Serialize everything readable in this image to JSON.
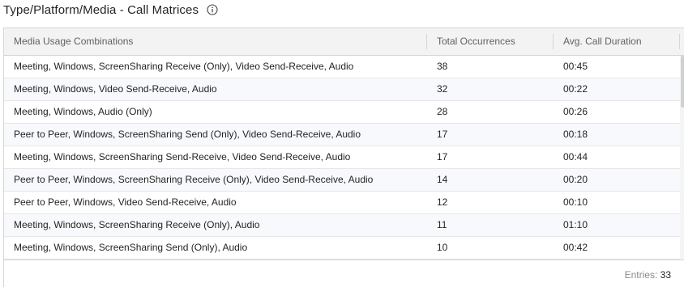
{
  "header": {
    "title": "Type/Platform/Media - Call Matrices",
    "info_icon": "info-circle-icon"
  },
  "table": {
    "columns": [
      "Media Usage Combinations",
      "Total Occurrences",
      "Avg. Call Duration"
    ],
    "rows": [
      {
        "combo": "Meeting, Windows, ScreenSharing Receive (Only), Video Send-Receive, Audio",
        "occurrences": "38",
        "duration": "00:45"
      },
      {
        "combo": "Meeting, Windows, Video Send-Receive, Audio",
        "occurrences": "32",
        "duration": "00:22"
      },
      {
        "combo": "Meeting, Windows, Audio (Only)",
        "occurrences": "28",
        "duration": "00:26"
      },
      {
        "combo": "Peer to Peer, Windows, ScreenSharing Send (Only), Video Send-Receive, Audio",
        "occurrences": "17",
        "duration": "00:18"
      },
      {
        "combo": "Meeting, Windows, ScreenSharing Send-Receive, Video Send-Receive, Audio",
        "occurrences": "17",
        "duration": "00:44"
      },
      {
        "combo": "Peer to Peer, Windows, ScreenSharing Receive (Only), Video Send-Receive, Audio",
        "occurrences": "14",
        "duration": "00:20"
      },
      {
        "combo": "Peer to Peer, Windows, Video Send-Receive, Audio",
        "occurrences": "12",
        "duration": "00:10"
      },
      {
        "combo": "Meeting, Windows, ScreenSharing Receive (Only), Audio",
        "occurrences": "11",
        "duration": "01:10"
      },
      {
        "combo": "Meeting, Windows, ScreenSharing Send (Only), Audio",
        "occurrences": "10",
        "duration": "00:42"
      }
    ]
  },
  "footer": {
    "entries_label": "Entries:",
    "entries_value": "33"
  }
}
